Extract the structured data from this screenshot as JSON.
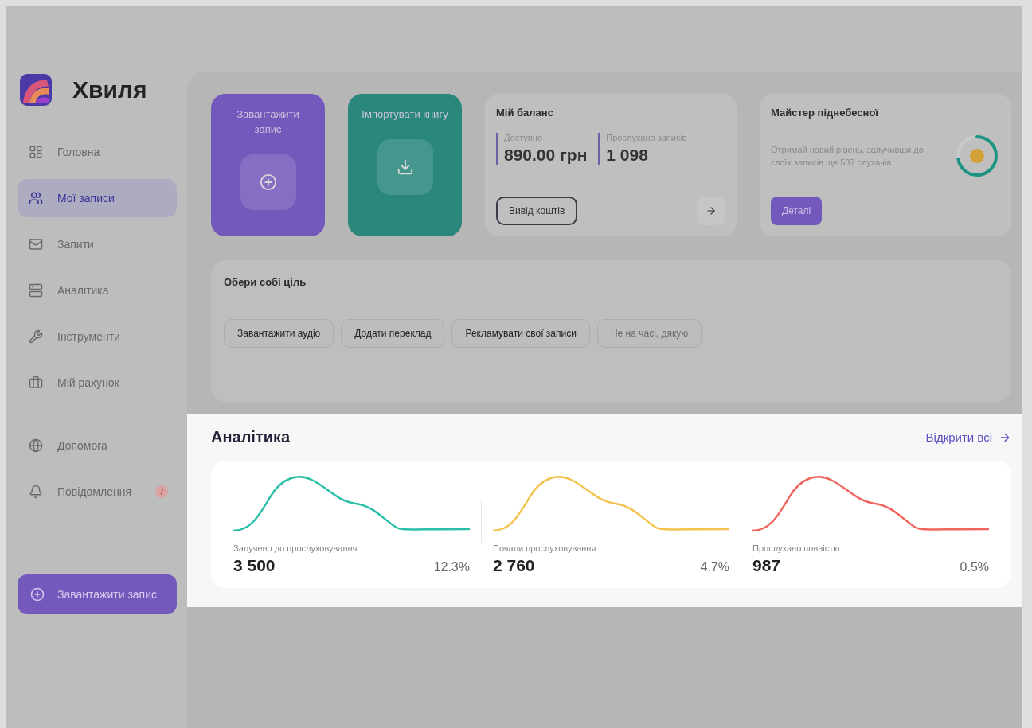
{
  "sidebar": {
    "brand": "Хвиля",
    "items": [
      {
        "label": "Головна",
        "selected": false
      },
      {
        "label": "Мої записи",
        "selected": true
      },
      {
        "label": "Запити",
        "selected": false
      },
      {
        "label": "Аналітика",
        "selected": false
      },
      {
        "label": "Інструменти",
        "selected": false
      },
      {
        "label": "Мій рахунок",
        "selected": false
      }
    ],
    "secondary_items": [
      {
        "label": "Допомога"
      },
      {
        "label": "Повідомлення",
        "badge": "7"
      }
    ],
    "cta": "Завантажити запис"
  },
  "quick_actions": [
    {
      "label": "Завантажити запис",
      "color": "#7459bd",
      "kind": "plus"
    },
    {
      "label": "Імпортувати книгу",
      "color": "#2a877b",
      "kind": "download"
    }
  ],
  "balance": {
    "title": "Мій баланс",
    "stats": [
      {
        "label": "Доступно",
        "value": "890.00 грн"
      },
      {
        "label": "Прослухано записів",
        "value": "1 098"
      }
    ],
    "button": "Вивід коштів"
  },
  "level_card": {
    "title": "Майстер піднебесної",
    "text": "Отримай новий рівень, залучивши до своїх записів ще 587 слухачів",
    "button": "Деталі"
  },
  "goals": {
    "title": "Обери собі ціль",
    "chips": [
      {
        "label": "Завантажити аудіо",
        "kind": "action"
      },
      {
        "label": "Додати переклад",
        "kind": "action"
      },
      {
        "label": "Рекламувати свої записи",
        "kind": "action"
      },
      {
        "label": "Не на часі, дякую",
        "kind": "dismiss"
      }
    ]
  },
  "analytics": {
    "title": "Аналітика",
    "link": "Відкрити всі",
    "metrics": [
      {
        "label": "Залучено до прослуховування",
        "value": "3 500",
        "change": "12.3%",
        "color": "#2bbfa8"
      },
      {
        "label": "Почали прослуховування",
        "value": "2 760",
        "change": "4.7%",
        "color": "#f4c34f"
      },
      {
        "label": "Прослухано повністю",
        "value": "987",
        "change": "0.5%",
        "color": "#f0665e"
      }
    ]
  }
}
